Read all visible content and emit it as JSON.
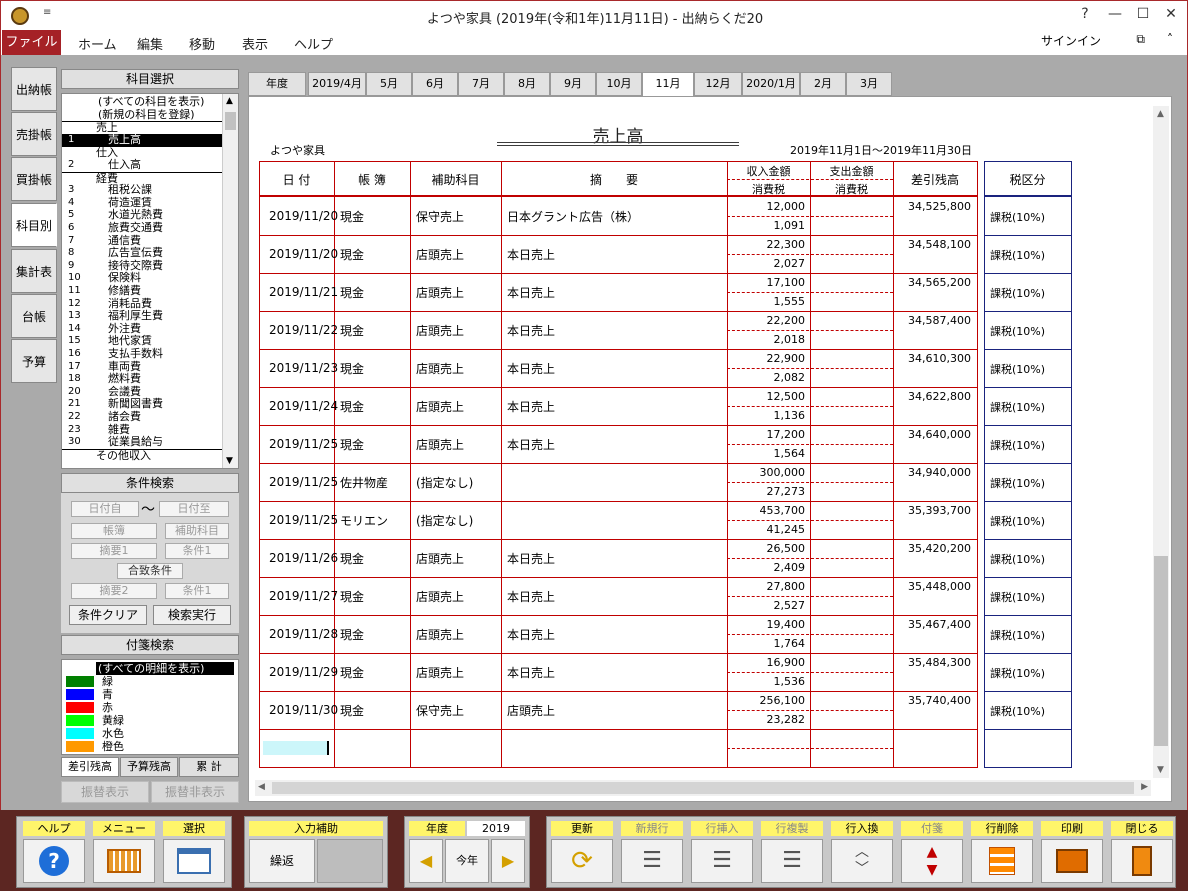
{
  "window": {
    "title": "よつや家具 (2019年(令和1年)11月11日) - 出納らくだ20",
    "qat_glyph": "≡",
    "controls": [
      "?",
      "—",
      "☐",
      "✕"
    ]
  },
  "menu": {
    "file": "ファイル",
    "items": [
      "ホーム",
      "編集",
      "移動",
      "表示",
      "ヘルプ"
    ],
    "signin": "サインイン",
    "restore": "⧉",
    "up": "˄"
  },
  "side_tabs": [
    "出納帳",
    "売掛帳",
    "買掛帳",
    "科目別",
    "集計表",
    "台帳",
    "予算"
  ],
  "side_tabs_active": 3,
  "account_select": {
    "header": "科目選択",
    "items": [
      {
        "no": "",
        "name": "(すべての科目を表示)",
        "type": "opt"
      },
      {
        "no": "",
        "name": "(新規の科目を登録)",
        "type": "opt"
      },
      {
        "no": "",
        "name": "売上",
        "type": "grp"
      },
      {
        "no": "1",
        "name": "売上高",
        "type": "sel"
      },
      {
        "no": "",
        "name": "仕入",
        "type": "grp"
      },
      {
        "no": "2",
        "name": "仕入高",
        "type": "item"
      },
      {
        "no": "",
        "name": "経費",
        "type": "grp"
      },
      {
        "no": "3",
        "name": "租税公課",
        "type": "item"
      },
      {
        "no": "4",
        "name": "荷造運賃",
        "type": "item"
      },
      {
        "no": "5",
        "name": "水道光熱費",
        "type": "item"
      },
      {
        "no": "6",
        "name": "旅費交通費",
        "type": "item"
      },
      {
        "no": "7",
        "name": "通信費",
        "type": "item"
      },
      {
        "no": "8",
        "name": "広告宣伝費",
        "type": "item"
      },
      {
        "no": "9",
        "name": "接待交際費",
        "type": "item"
      },
      {
        "no": "10",
        "name": "保険料",
        "type": "item"
      },
      {
        "no": "11",
        "name": "修繕費",
        "type": "item"
      },
      {
        "no": "12",
        "name": "消耗品費",
        "type": "item"
      },
      {
        "no": "13",
        "name": "福利厚生費",
        "type": "item"
      },
      {
        "no": "14",
        "name": "外注費",
        "type": "item"
      },
      {
        "no": "15",
        "name": "地代家賃",
        "type": "item"
      },
      {
        "no": "16",
        "name": "支払手数料",
        "type": "item"
      },
      {
        "no": "17",
        "name": "車両費",
        "type": "item"
      },
      {
        "no": "18",
        "name": "燃料費",
        "type": "item"
      },
      {
        "no": "20",
        "name": "会議費",
        "type": "item"
      },
      {
        "no": "21",
        "name": "新聞図書費",
        "type": "item"
      },
      {
        "no": "22",
        "name": "諸会費",
        "type": "item"
      },
      {
        "no": "23",
        "name": "雑費",
        "type": "item"
      },
      {
        "no": "30",
        "name": "従業員給与",
        "type": "item"
      },
      {
        "no": "",
        "name": "その他収入",
        "type": "grp"
      }
    ]
  },
  "condition_search": {
    "header": "条件検索",
    "date_from": "日付自",
    "tilde": "〜",
    "date_to": "日付至",
    "ledger": "帳簿",
    "sub_account": "補助科目",
    "memo1": "摘要1",
    "cond1": "条件1",
    "match": "合致条件",
    "memo2": "摘要2",
    "cond2": "条件1",
    "clear_btn": "条件クリア",
    "search_btn": "検索実行"
  },
  "tag_search": {
    "header": "付箋検索",
    "all": "(すべての明細を表示)",
    "tags": [
      {
        "name": "緑",
        "color": "#008000"
      },
      {
        "name": "青",
        "color": "#0000ff"
      },
      {
        "name": "赤",
        "color": "#ff0000"
      },
      {
        "name": "黄緑",
        "color": "#00ff00"
      },
      {
        "name": "水色",
        "color": "#00ffff"
      },
      {
        "name": "橙色",
        "color": "#ff9900"
      }
    ],
    "tabs": [
      "差引残高",
      "予算残高",
      "累 計"
    ],
    "btn_show": "振替表示",
    "btn_hide": "振替非表示"
  },
  "month_tabs": [
    "年度",
    "2019/4月",
    "5月",
    "6月",
    "7月",
    "8月",
    "9月",
    "10月",
    "11月",
    "12月",
    "2020/1月",
    "2月",
    "3月"
  ],
  "month_active": 8,
  "report": {
    "title": "売上高",
    "company": "よつや家具",
    "period": "2019年11月1日〜2019年11月30日"
  },
  "columns": {
    "date": "日 付",
    "ledger": "帳 簿",
    "sub": "補助科目",
    "memo": "摘　　要",
    "income": "収入金額",
    "income_tax": "消費税",
    "expense": "支出金額",
    "expense_tax": "消費税",
    "balance": "差引残高",
    "tax_class": "税区分"
  },
  "rows": [
    {
      "date": "2019/11/20",
      "ledger": "現金",
      "sub": "保守売上",
      "memo": "日本グラント広告（株）",
      "income": "12,000",
      "tax": "1,091",
      "balance": "34,525,800",
      "cls": "課税(10%)"
    },
    {
      "date": "2019/11/20",
      "ledger": "現金",
      "sub": "店頭売上",
      "memo": "本日売上",
      "income": "22,300",
      "tax": "2,027",
      "balance": "34,548,100",
      "cls": "課税(10%)"
    },
    {
      "date": "2019/11/21",
      "ledger": "現金",
      "sub": "店頭売上",
      "memo": "本日売上",
      "income": "17,100",
      "tax": "1,555",
      "balance": "34,565,200",
      "cls": "課税(10%)"
    },
    {
      "date": "2019/11/22",
      "ledger": "現金",
      "sub": "店頭売上",
      "memo": "本日売上",
      "income": "22,200",
      "tax": "2,018",
      "balance": "34,587,400",
      "cls": "課税(10%)"
    },
    {
      "date": "2019/11/23",
      "ledger": "現金",
      "sub": "店頭売上",
      "memo": "本日売上",
      "income": "22,900",
      "tax": "2,082",
      "balance": "34,610,300",
      "cls": "課税(10%)"
    },
    {
      "date": "2019/11/24",
      "ledger": "現金",
      "sub": "店頭売上",
      "memo": "本日売上",
      "income": "12,500",
      "tax": "1,136",
      "balance": "34,622,800",
      "cls": "課税(10%)"
    },
    {
      "date": "2019/11/25",
      "ledger": "現金",
      "sub": "店頭売上",
      "memo": "本日売上",
      "income": "17,200",
      "tax": "1,564",
      "balance": "34,640,000",
      "cls": "課税(10%)"
    },
    {
      "date": "2019/11/25",
      "ledger": "佐井物産",
      "sub": "(指定なし)",
      "memo": "",
      "income": "300,000",
      "tax": "27,273",
      "balance": "34,940,000",
      "cls": "課税(10%)"
    },
    {
      "date": "2019/11/25",
      "ledger": "モリエン",
      "sub": "(指定なし)",
      "memo": "",
      "income": "453,700",
      "tax": "41,245",
      "balance": "35,393,700",
      "cls": "課税(10%)"
    },
    {
      "date": "2019/11/26",
      "ledger": "現金",
      "sub": "店頭売上",
      "memo": "本日売上",
      "income": "26,500",
      "tax": "2,409",
      "balance": "35,420,200",
      "cls": "課税(10%)"
    },
    {
      "date": "2019/11/27",
      "ledger": "現金",
      "sub": "店頭売上",
      "memo": "本日売上",
      "income": "27,800",
      "tax": "2,527",
      "balance": "35,448,000",
      "cls": "課税(10%)"
    },
    {
      "date": "2019/11/28",
      "ledger": "現金",
      "sub": "店頭売上",
      "memo": "本日売上",
      "income": "19,400",
      "tax": "1,764",
      "balance": "35,467,400",
      "cls": "課税(10%)"
    },
    {
      "date": "2019/11/29",
      "ledger": "現金",
      "sub": "店頭売上",
      "memo": "本日売上",
      "income": "16,900",
      "tax": "1,536",
      "balance": "35,484,300",
      "cls": "課税(10%)"
    },
    {
      "date": "2019/11/30",
      "ledger": "現金",
      "sub": "保守売上",
      "memo": "店頭売上",
      "income": "256,100",
      "tax": "23,282",
      "balance": "35,740,400",
      "cls": "課税(10%)"
    }
  ],
  "toolbar": {
    "help": "ヘルプ",
    "menu": "メニュー",
    "select": "選択",
    "input_assist": "入力補助",
    "repeat": "繰返",
    "year_label": "年度",
    "year": "2019",
    "this_year": "今年",
    "update": "更新",
    "new_row": "新規行",
    "insert_row": "行挿入",
    "copy_row": "行複製",
    "swap_row": "行入換",
    "tag": "付箋",
    "delete_row": "行削除",
    "print": "印刷",
    "close": "閉じる"
  },
  "colors": {
    "accent": "#a52126",
    "bottom_bar": "#5c2622",
    "grid_red": "#c00000",
    "grid_blue": "#1a237e",
    "label_yellow": "#fff56a"
  }
}
